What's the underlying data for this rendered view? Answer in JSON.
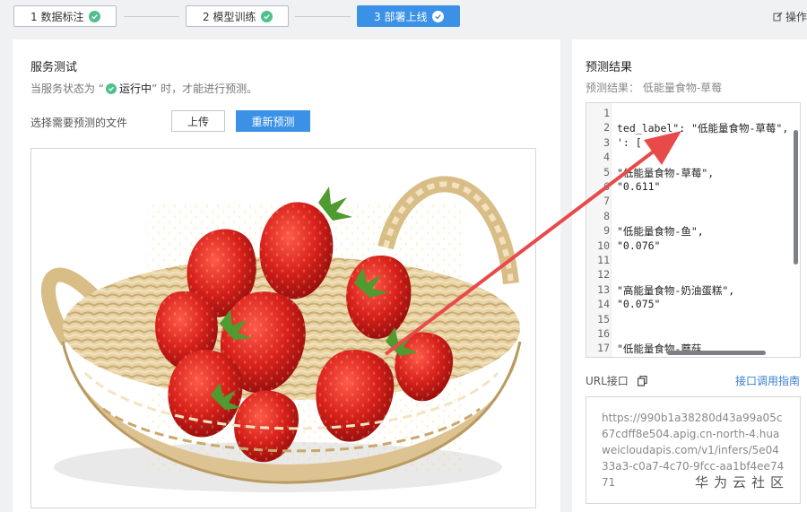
{
  "steps": [
    {
      "label": "1 数据标注",
      "done": true
    },
    {
      "label": "2 模型训练",
      "done": true
    },
    {
      "label": "3 部署上线",
      "done": true
    }
  ],
  "ops_label": "操作",
  "service_test": {
    "title": "服务测试",
    "desc_prefix": "当服务状态为 “",
    "desc_status": "运行中",
    "desc_suffix": "” 时，才能进行预测。",
    "file_label": "选择需要预测的文件",
    "upload_button": "上传",
    "repredict_button": "重新预测"
  },
  "result": {
    "title": "预测结果",
    "summary": "预测结果： 低能量食物-草莓",
    "code_lines": [
      {
        "n": "1",
        "t": ""
      },
      {
        "n": "2",
        "t": "ted_label\": \"低能量食物-草莓\","
      },
      {
        "n": "3",
        "t": "': ["
      },
      {
        "n": "4",
        "t": ""
      },
      {
        "n": "5",
        "t": "\"低能量食物-草莓\","
      },
      {
        "n": "6",
        "t": "\"0.611\""
      },
      {
        "n": "7",
        "t": ""
      },
      {
        "n": "8",
        "t": ""
      },
      {
        "n": "9",
        "t": "\"低能量食物-鱼\","
      },
      {
        "n": "10",
        "t": "\"0.076\""
      },
      {
        "n": "11",
        "t": ""
      },
      {
        "n": "12",
        "t": ""
      },
      {
        "n": "13",
        "t": "\"高能量食物-奶油蛋糕\","
      },
      {
        "n": "14",
        "t": "\"0.075\""
      },
      {
        "n": "15",
        "t": ""
      },
      {
        "n": "16",
        "t": ""
      },
      {
        "n": "17",
        "t": "\"低能量食物-蘑菇"
      }
    ]
  },
  "url": {
    "label": "URL接口",
    "guide_link": "接口调用指南",
    "value": "https://990b1a38280d43a99a05c67cdff8e504.apig.cn-north-4.huaweicloudapis.com/v1/infers/5e0433a3-c0a7-4c70-9fcc-aa1bf4ee7471"
  },
  "watermark": "华为云社区",
  "colors": {
    "primary": "#3a91e6",
    "success": "#4fc08d",
    "arrow": "#e84a4a",
    "link": "#3a81d1"
  }
}
